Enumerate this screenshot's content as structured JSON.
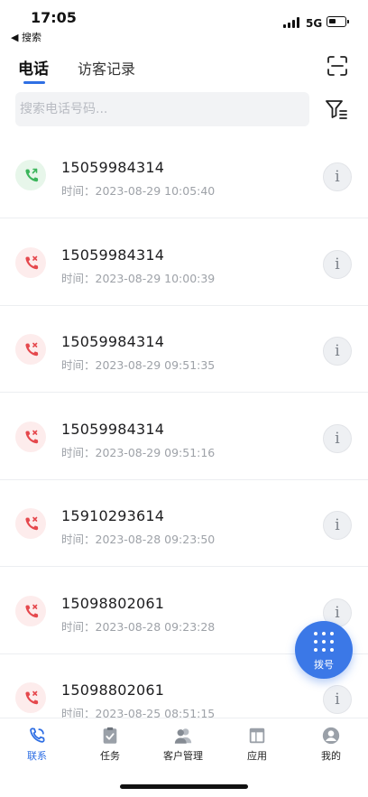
{
  "status_bar": {
    "time": "17:05",
    "back_app": "◀ 搜索",
    "network": "5G"
  },
  "tabs": [
    {
      "label": "电话",
      "active": true
    },
    {
      "label": "访客记录",
      "active": false
    }
  ],
  "search": {
    "placeholder": "搜索电话号码...",
    "value": ""
  },
  "calls": [
    {
      "number": "15059984314",
      "time": "时间：2023-08-29 10:05:40",
      "status": "answered"
    },
    {
      "number": "15059984314",
      "time": "时间：2023-08-29 10:00:39",
      "status": "missed"
    },
    {
      "number": "15059984314",
      "time": "时间：2023-08-29 09:51:35",
      "status": "missed"
    },
    {
      "number": "15059984314",
      "time": "时间：2023-08-29 09:51:16",
      "status": "missed"
    },
    {
      "number": "15910293614",
      "time": "时间：2023-08-28 09:23:50",
      "status": "missed"
    },
    {
      "number": "15098802061",
      "time": "时间：2023-08-28 09:23:28",
      "status": "missed"
    },
    {
      "number": "15098802061",
      "time": "时间：2023-08-25 08:51:15",
      "status": "missed"
    }
  ],
  "info_glyph": "i",
  "dial_button": {
    "label": "拨号"
  },
  "bottom_nav": [
    {
      "label": "联系",
      "icon": "phone-icon",
      "active": true
    },
    {
      "label": "任务",
      "icon": "task-clipboard-icon",
      "active": false
    },
    {
      "label": "客户管理",
      "icon": "customers-icon",
      "active": false
    },
    {
      "label": "应用",
      "icon": "apps-icon",
      "active": false
    },
    {
      "label": "我的",
      "icon": "profile-icon",
      "active": false
    }
  ],
  "colors": {
    "accent": "#2f6fe4",
    "answered": "#3bb55b",
    "missed": "#e5484d",
    "nav_icon_gray": "#9aa0a8"
  }
}
